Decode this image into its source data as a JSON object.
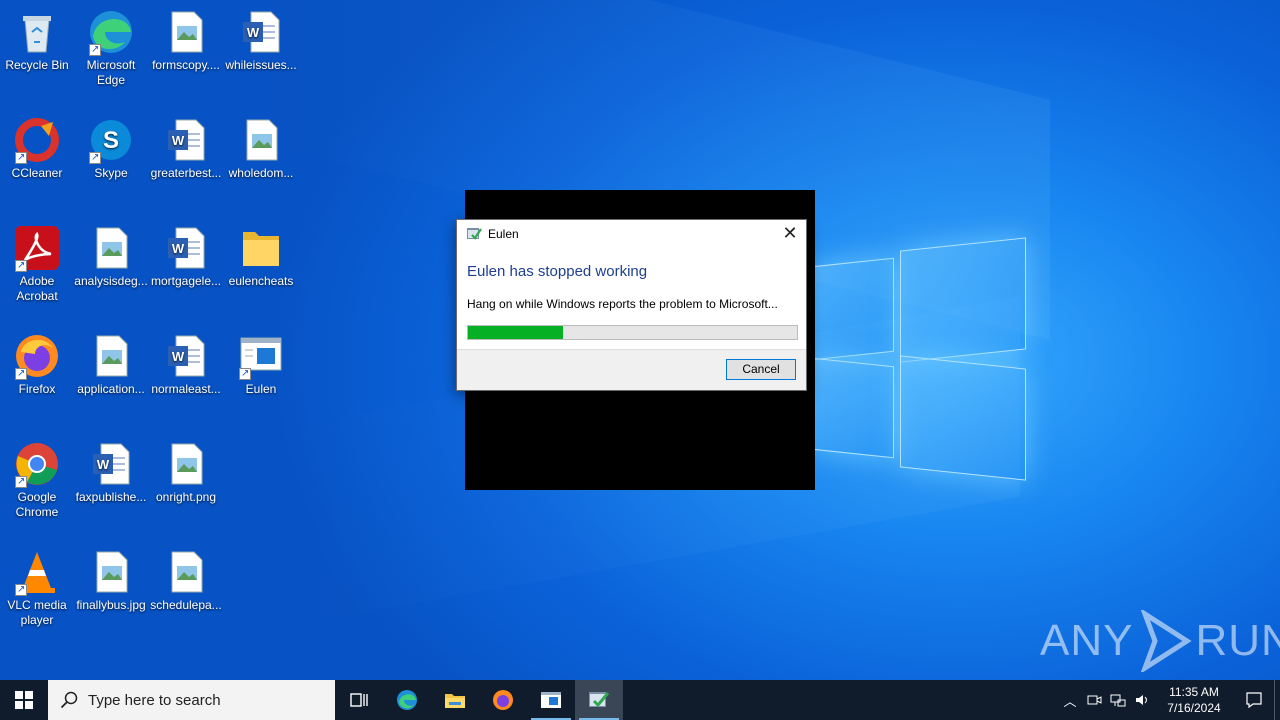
{
  "desktop": {
    "icons": [
      {
        "label": "Recycle Bin",
        "icon": "recycle-bin-icon"
      },
      {
        "label": "Microsoft Edge",
        "icon": "edge-icon"
      },
      {
        "label": "formscopy....",
        "icon": "image-file-icon"
      },
      {
        "label": "whileissues...",
        "icon": "word-doc-icon"
      },
      {
        "label": "CCleaner",
        "icon": "ccleaner-icon"
      },
      {
        "label": "Skype",
        "icon": "skype-icon"
      },
      {
        "label": "greaterbest...",
        "icon": "word-doc-icon"
      },
      {
        "label": "wholedom...",
        "icon": "image-file-icon"
      },
      {
        "label": "Adobe Acrobat",
        "icon": "acrobat-icon"
      },
      {
        "label": "analysisdeg...",
        "icon": "image-file-icon"
      },
      {
        "label": "mortgagele...",
        "icon": "word-doc-icon"
      },
      {
        "label": "eulencheats",
        "icon": "folder-icon"
      },
      {
        "label": "Firefox",
        "icon": "firefox-icon"
      },
      {
        "label": "application...",
        "icon": "image-file-icon"
      },
      {
        "label": "normaleast...",
        "icon": "word-doc-icon"
      },
      {
        "label": "Eulen",
        "icon": "app-window-icon"
      },
      {
        "label": "Google Chrome",
        "icon": "chrome-icon"
      },
      {
        "label": "faxpublishe...",
        "icon": "word-doc-icon"
      },
      {
        "label": "onright.png",
        "icon": "image-file-icon"
      },
      {
        "label": "VLC media player",
        "icon": "vlc-icon"
      },
      {
        "label": "finallybus.jpg",
        "icon": "image-file-icon"
      },
      {
        "label": "schedulepa...",
        "icon": "image-file-icon"
      }
    ]
  },
  "dialog": {
    "title": "Eulen",
    "heading": "Eulen has stopped working",
    "message": "Hang on while Windows reports the problem to Microsoft...",
    "progress": 0.29,
    "cancel_label": "Cancel",
    "progress_color": "#06b025"
  },
  "watermark": {
    "left": "ANY",
    "right": "RUN"
  },
  "taskbar": {
    "search_placeholder": "Type here to search",
    "pinned": [
      "task-view-icon",
      "edge-icon",
      "file-explorer-icon",
      "firefox-icon",
      "app-window-icon",
      "eulen-app-icon"
    ],
    "clock_time": "11:35 AM",
    "clock_date": "7/16/2024"
  },
  "colors": {
    "accent": "#0078d7",
    "taskbar": "#101b2b",
    "heading": "#1e3f8f"
  }
}
